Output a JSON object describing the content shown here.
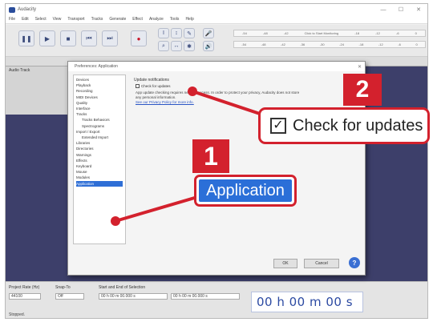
{
  "app": {
    "title": "Audacity",
    "menu": [
      "File",
      "Edit",
      "Select",
      "View",
      "Transport",
      "Tracks",
      "Generate",
      "Effect",
      "Analyze",
      "Tools",
      "Help"
    ],
    "meter_text": "Click to Start Monitoring",
    "track_name": "Audio Track"
  },
  "bottom": {
    "project_rate_label": "Project Rate (Hz)",
    "project_rate_value": "44100",
    "snap_to_label": "Snap-To",
    "snap_to_value": "Off",
    "selection_label": "Start and End of Selection",
    "selection_start": "00 h 00 m 00.000 s",
    "selection_end": "00 h 00 m 00.000 s",
    "time_display": "00 h 00 m 00 s",
    "status": "Stopped."
  },
  "dialog": {
    "title": "Preferences: Application",
    "close_icon": "close-icon",
    "tree_items": [
      {
        "label": "Devices",
        "indent": false,
        "selected": false
      },
      {
        "label": "Playback",
        "indent": false,
        "selected": false
      },
      {
        "label": "Recording",
        "indent": false,
        "selected": false
      },
      {
        "label": "MIDI Devices",
        "indent": false,
        "selected": false
      },
      {
        "label": "Quality",
        "indent": false,
        "selected": false
      },
      {
        "label": "Interface",
        "indent": false,
        "selected": false
      },
      {
        "label": "Tracks",
        "indent": false,
        "selected": false
      },
      {
        "label": "Tracks Behaviors",
        "indent": true,
        "selected": false
      },
      {
        "label": "Spectrograms",
        "indent": true,
        "selected": false
      },
      {
        "label": "Import / Export",
        "indent": false,
        "selected": false
      },
      {
        "label": "Extended Import",
        "indent": true,
        "selected": false
      },
      {
        "label": "Libraries",
        "indent": false,
        "selected": false
      },
      {
        "label": "Directories",
        "indent": false,
        "selected": false
      },
      {
        "label": "Warnings",
        "indent": false,
        "selected": false
      },
      {
        "label": "Effects",
        "indent": false,
        "selected": false
      },
      {
        "label": "Keyboard",
        "indent": false,
        "selected": false
      },
      {
        "label": "Mouse",
        "indent": false,
        "selected": false
      },
      {
        "label": "Modules",
        "indent": false,
        "selected": false
      },
      {
        "label": "Application",
        "indent": false,
        "selected": true
      }
    ],
    "group_label": "Update notifications",
    "check_label": "Check for updates",
    "description": "App update checking requires network access. In order to protect your privacy, Audacity does not store any personal information.",
    "privacy_link": "See our Privacy Policy for more info.",
    "ok_label": "OK",
    "cancel_label": "Cancel",
    "help_label": "?"
  },
  "callouts": {
    "badge_1": "1",
    "badge_2": "2",
    "zoom_application": "Application",
    "zoom_check": "Check for updates",
    "accent_color": "#d3212d"
  }
}
